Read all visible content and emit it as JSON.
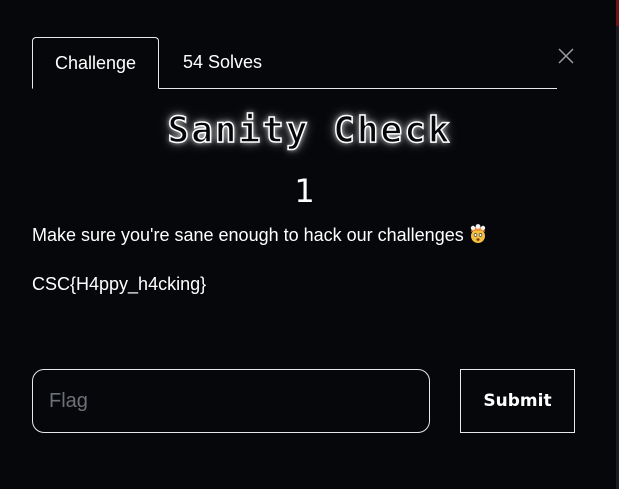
{
  "tabs": {
    "challenge_label": "Challenge",
    "solves_label": "54 Solves"
  },
  "challenge": {
    "title": "Sanity Check",
    "points": "1",
    "description": "Make sure you're sane enough to hack our challenges",
    "description_emoji": "exploding-head-emoji",
    "flag_text": "CSC{H4ppy_h4cking}"
  },
  "form": {
    "flag_placeholder": "Flag",
    "flag_value": "",
    "submit_label": "Submit"
  },
  "icons": {
    "close": "close-icon"
  },
  "colors": {
    "background": "#05070b",
    "border": "#e8e8e8",
    "text": "#ffffff",
    "placeholder": "#6d7075",
    "scroll_accent": "#6a1414"
  }
}
